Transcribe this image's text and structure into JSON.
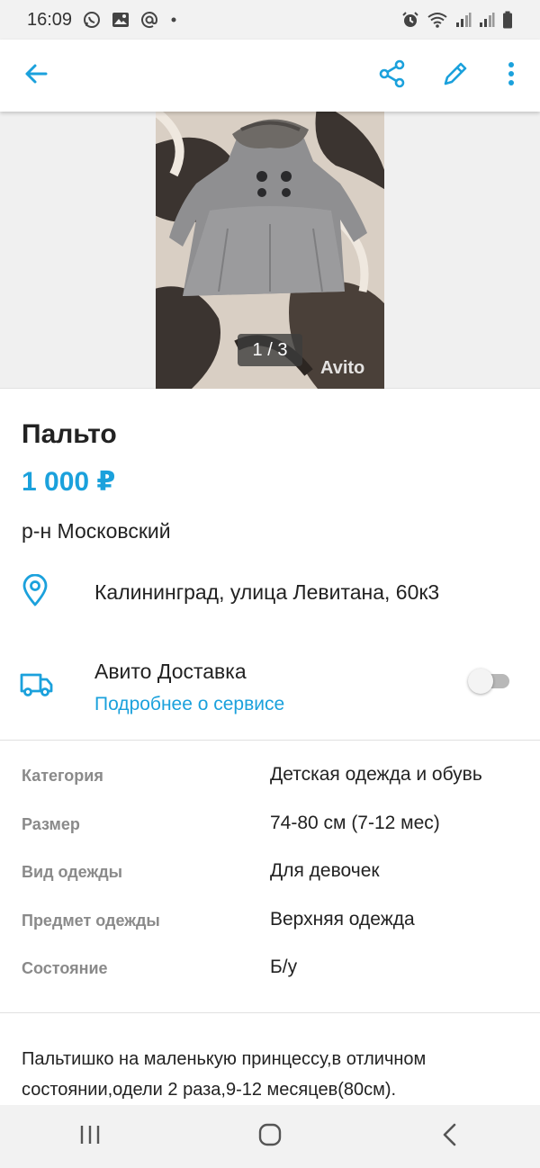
{
  "status_bar": {
    "time": "16:09",
    "left_icons": [
      "whatsapp-icon",
      "image-icon",
      "at-icon",
      "dot-icon"
    ],
    "right_icons": [
      "alarm-icon",
      "wifi-icon",
      "signal-icon",
      "signal-icon",
      "battery-icon"
    ]
  },
  "app_bar": {
    "icons": [
      "arrow-left-icon",
      "share-icon",
      "pencil-icon",
      "more-vertical-icon"
    ],
    "accent": "#1ba1dc"
  },
  "photo": {
    "counter": "1 / 3",
    "watermark": "Avito"
  },
  "listing": {
    "title": "Пальто",
    "price": "1 000 ₽",
    "district": "р-н Московский",
    "address": "Калининград, улица Левитана, 60к3"
  },
  "delivery": {
    "title": "Авито Доставка",
    "link": "Подробнее о сервисе",
    "enabled": false
  },
  "params": [
    {
      "key": "Категория",
      "value": "Детская одежда и обувь"
    },
    {
      "key": "Размер",
      "value": "74-80 см (7-12 мес)"
    },
    {
      "key": "Вид одежды",
      "value": "Для девочек"
    },
    {
      "key": "Предмет одежды",
      "value": "Верхняя одежда"
    },
    {
      "key": "Состояние",
      "value": "Б/у"
    }
  ],
  "description": "Пальтишко на маленькую принцессу,в отличном состоянии,одели 2 раза,9-12 месяцев(80см).",
  "nav_bar": {
    "icons": [
      "recent-apps-icon",
      "home-icon",
      "back-icon"
    ]
  }
}
